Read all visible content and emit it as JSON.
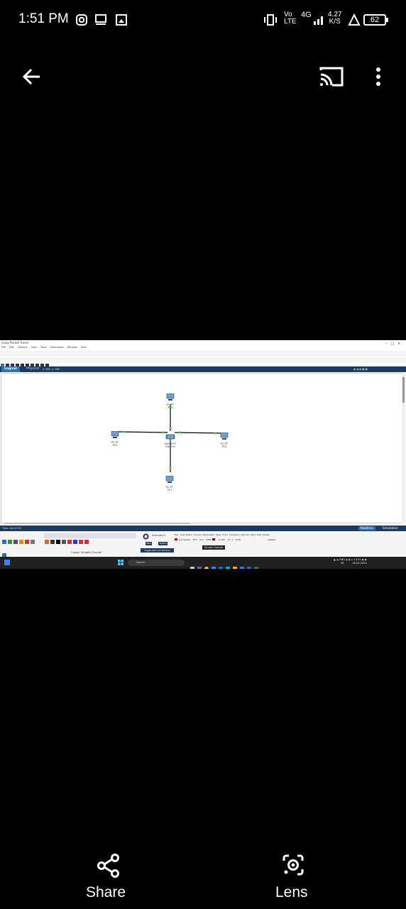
{
  "status_bar": {
    "time": "1:51 PM",
    "network_type_top": "Vo",
    "network_type_bottom": "LTE",
    "cell_type": "4G",
    "net_speed_value": "4.27",
    "net_speed_unit": "K/S",
    "battery_level": "62"
  },
  "toolbar": {
    "icons": [
      "back-arrow-icon",
      "cast-icon",
      "more-vert-icon"
    ]
  },
  "packet_tracer": {
    "window_title": "Cisco Packet Tracer",
    "menu": [
      "File",
      "Edit",
      "Options",
      "View",
      "Tools",
      "Extensions",
      "Window",
      "Help"
    ],
    "tabs": {
      "logical": "Logical",
      "physical": "Physical"
    },
    "tab_path": "x: 665, y: 569",
    "devices": [
      {
        "id": "pc-top",
        "type_label": "PC-PT",
        "name": "PC2"
      },
      {
        "id": "pc-left",
        "type_label": "PC-PT",
        "name": "PC0"
      },
      {
        "id": "switch",
        "type_label": "Switch-PT",
        "name": "Switch0"
      },
      {
        "id": "pc-right",
        "type_label": "PC-PT",
        "name": "PC3"
      },
      {
        "id": "pc-bottom",
        "type_label": "PC-PT",
        "name": "PC1"
      }
    ],
    "sim_time": "Time: 00:47:33",
    "mode_buttons": {
      "realtime": "Realtime",
      "simulation": "Simulation"
    },
    "device_caption": "Copper Straight-Through",
    "scenario": {
      "label": "Scenario 0",
      "new": "New",
      "delete": "Delete",
      "pdu_toggle": "Toggle PDU List Window"
    },
    "pdu_table": {
      "headers": [
        "Fire",
        "Last Status",
        "Source",
        "Destination",
        "Type",
        "Color",
        "Time(sec)",
        "Periodic",
        "Num",
        "Edit",
        "Delete"
      ],
      "row": [
        "",
        "Successful",
        "PC0",
        "PC1",
        "ICMP",
        "",
        "0.000",
        "N",
        "0",
        "(edit)",
        "(delete)"
      ]
    },
    "tooltip": "Simple Closure",
    "taskbar": {
      "search_placeholder": "Search",
      "tray_lang": "ENG",
      "tray_region": "IN",
      "tray_time": "14:51",
      "tray_date": "30-03-2024"
    }
  },
  "bottom_actions": {
    "share": "Share",
    "lens": "Lens"
  }
}
